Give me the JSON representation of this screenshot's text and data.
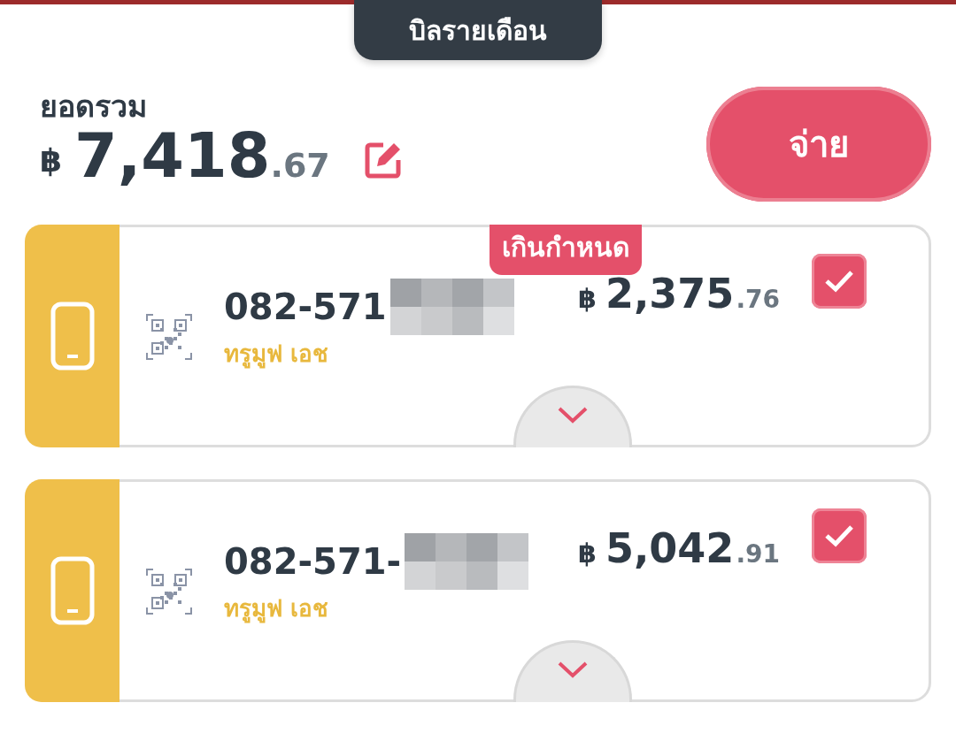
{
  "header_tab": {
    "label": "บิลรายเดือน",
    "selected": true
  },
  "total": {
    "label": "ยอดรวม",
    "currency": "฿",
    "whole": "7,418",
    "decimal": ".67"
  },
  "pay_button": {
    "label": "จ่าย"
  },
  "bills": [
    {
      "badge": "เกินกำหนด",
      "number": "082-571",
      "redacted": true,
      "operator": "ทรูมูฟ เอช",
      "currency": "฿",
      "whole": "2,375",
      "decimal": ".76",
      "checked": true
    },
    {
      "number": "082-571-",
      "redacted": true,
      "operator": "ทรูมูฟ เอช",
      "currency": "฿",
      "whole": "5,042",
      "decimal": ".91",
      "checked": true
    }
  ]
}
